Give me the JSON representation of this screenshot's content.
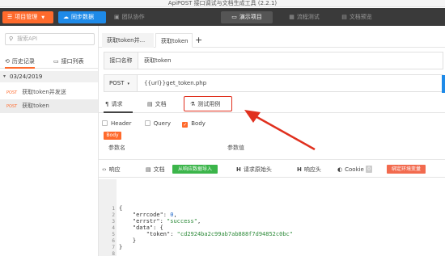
{
  "window": {
    "title": "ApiPOST 接口调试与文档生成工具 (2.2.1)"
  },
  "toolbar": {
    "project_label": "项目管理",
    "sync_label": "同步数据",
    "team_label": "团队协作",
    "demo_label": "演示项目",
    "flow_label": "流程测试",
    "doc_label": "文档预览"
  },
  "sidebar": {
    "search_placeholder": "搜索API",
    "tab_history": "历史记录",
    "tab_list": "接口列表",
    "date": "03/24/2019",
    "items": [
      {
        "method": "POST",
        "label": "获取token并发送",
        "selected": false
      },
      {
        "method": "POST",
        "label": "获取token",
        "selected": true
      }
    ]
  },
  "file_tabs": [
    {
      "label": "获取token并...",
      "active": false
    },
    {
      "label": "获取token",
      "active": true
    }
  ],
  "form": {
    "name_label": "接口名称",
    "name_value": "获取token",
    "method": "POST",
    "url": "{{url}}get_token.php"
  },
  "request_tabs": {
    "params": "请求",
    "docs": "文档",
    "test": "测试用例"
  },
  "param_options": {
    "header": "Header",
    "query": "Query",
    "body": "Body"
  },
  "body_badge": "Body",
  "columns": {
    "param_name": "参数名",
    "param_value": "参数值"
  },
  "response_tabs": {
    "response": "响应",
    "docs": "文档",
    "import": "从响应数据导入",
    "raw_request": "请求原始头",
    "response_header": "响应头",
    "cookie": "Cookie",
    "cookie_count": "0",
    "env_bind": "绑定环境变量"
  },
  "code_lines": [
    "1",
    "2",
    "3",
    "4",
    "5",
    "6",
    "7",
    "8"
  ],
  "code": {
    "l1": "{",
    "l2_key": "\"errcode\"",
    "l2_val": "0",
    "l3_key": "\"errstr\"",
    "l3_val": "\"success\"",
    "l4_key": "\"data\"",
    "l5_key": "\"token\"",
    "l5_val": "\"cd2924ba2c99ab7ab888f7d94852c0bc\"",
    "l6": "}",
    "l7": "}"
  },
  "colors": {
    "accent_orange": "#ff6a2c",
    "accent_blue": "#1e8ae8",
    "topbar": "#3a3a3a",
    "highlight_red": "#e0301e",
    "green": "#3bb54a"
  }
}
